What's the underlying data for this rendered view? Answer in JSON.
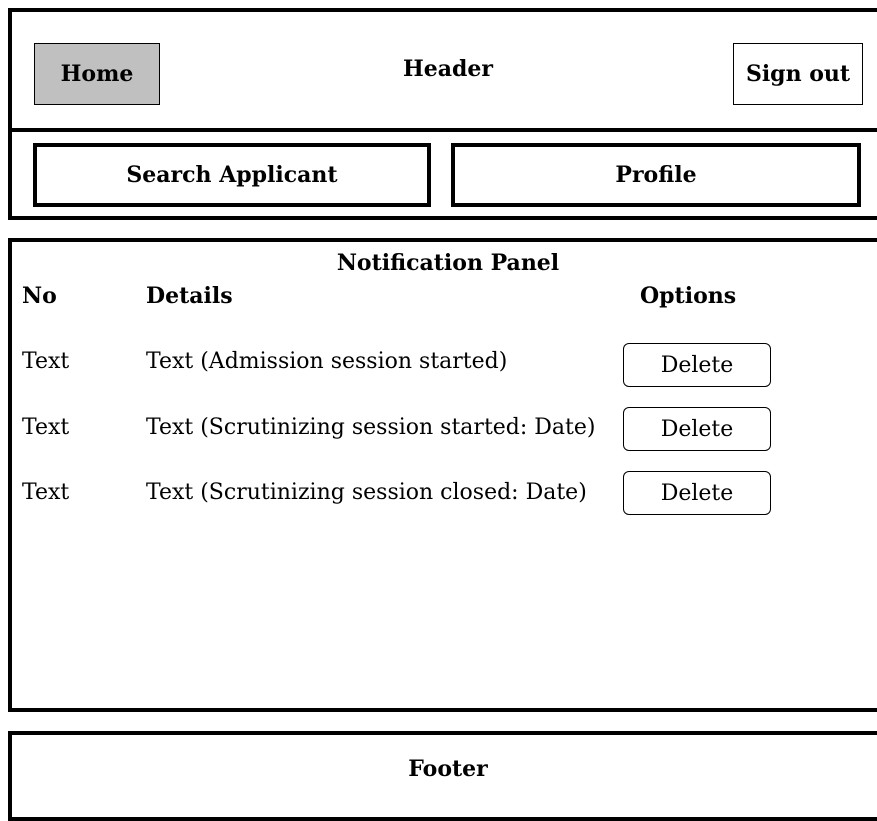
{
  "header": {
    "home_label": "Home",
    "title": "Header",
    "signout_label": "Sign out"
  },
  "nav": {
    "search_label": "Search Applicant",
    "profile_label": "Profile"
  },
  "panel": {
    "title": "Notification Panel",
    "columns": [
      "No",
      "Details",
      "Options"
    ],
    "rows": [
      {
        "no": "Text",
        "details": "Text (Admission session started)",
        "option": "Delete"
      },
      {
        "no": "Text",
        "details": "Text (Scrutinizing session started: Date)",
        "option": "Delete"
      },
      {
        "no": "Text",
        "details": "Text (Scrutinizing session closed: Date)",
        "option": "Delete"
      }
    ]
  },
  "footer": {
    "title": "Footer"
  },
  "colors": {
    "home_button_bg": "#c0c0c0",
    "border": "#000000",
    "background": "#ffffff"
  }
}
